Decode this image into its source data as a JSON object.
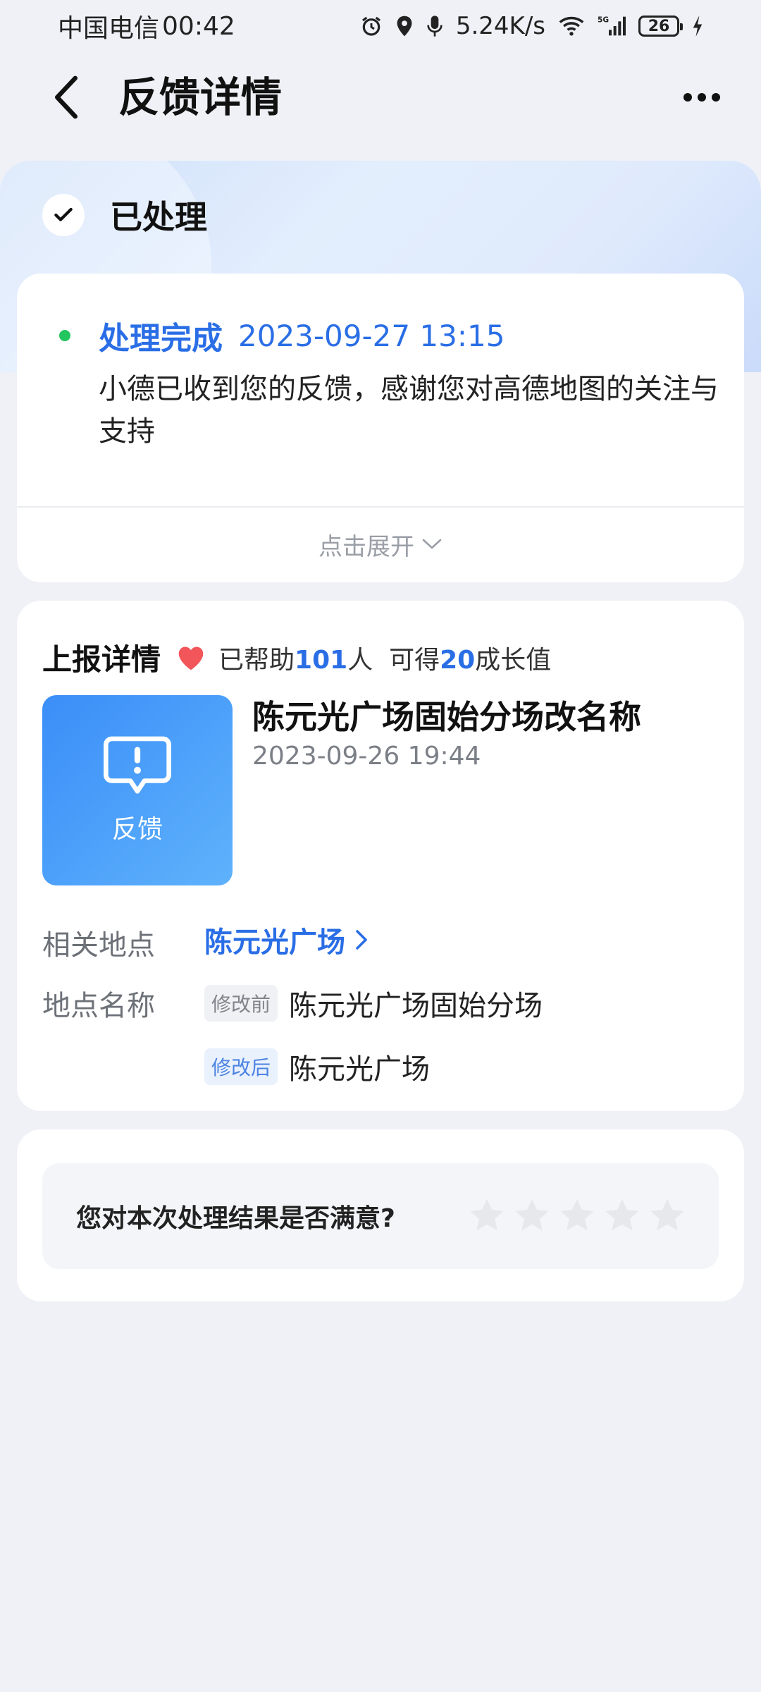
{
  "status_bar": {
    "carrier": "中国电信",
    "time": "00:42",
    "net_speed": "5.24K/s",
    "network": "5G",
    "battery": "26"
  },
  "header": {
    "title": "反馈详情"
  },
  "hero": {
    "status_label": "已处理"
  },
  "progress": {
    "label": "处理完成",
    "time": "2023-09-27 13:15",
    "message": "小德已收到您的反馈，感谢您对高德地图的关注与支持",
    "expand_label": "点击展开"
  },
  "report": {
    "title": "上报详情",
    "helped_prefix": "已帮助",
    "helped_count": "101",
    "helped_suffix": "人",
    "growth_prefix": "可得",
    "growth_value": "20",
    "growth_suffix": "成长值",
    "thumb_label": "反馈",
    "item_name": "陈元光广场固始分场改名称",
    "item_date": "2023-09-26 19:44",
    "related_place_label": "相关地点",
    "related_place_value": "陈元光广场",
    "place_name_label": "地点名称",
    "before_tag": "修改前",
    "before_value": "陈元光广场固始分场",
    "after_tag": "修改后",
    "after_value": "陈元光广场"
  },
  "rating": {
    "question": "您对本次处理结果是否满意?",
    "stars_total": 5,
    "stars_selected": 0
  },
  "colors": {
    "accent": "#2a6ee6",
    "success": "#22c55e",
    "heart": "#f2555a",
    "background": "#eff1f6"
  }
}
